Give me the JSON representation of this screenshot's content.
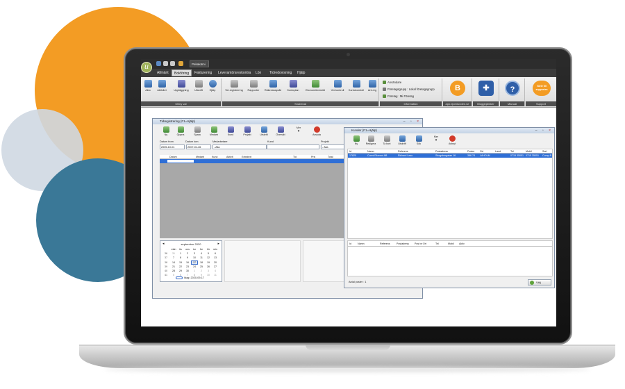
{
  "app": {
    "logo_letter": "u",
    "tab_title": "Pekakämi"
  },
  "menu": [
    "Allmänt",
    "Bokföring",
    "Fakturering",
    "Leverantörsreskontra",
    "Lön",
    "Tidredovisning",
    "Hjälp"
  ],
  "ribbon": {
    "group1_label": "Meny val",
    "group1_buttons": [
      "Akto",
      "Aktivitet",
      "Upplägg­ning",
      "Utskrift",
      "Hjälp"
    ],
    "group2_label": "Snabbval",
    "group2_buttons": [
      "Ver.registrering",
      "Rapporter",
      "Räkenskapsår",
      "Kontoplan",
      "Ekonomiöversikt",
      "Ver.kontroll",
      "Kontokontroll",
      "Ant.reg"
    ],
    "info_label": "Information",
    "info_lines": [
      "Användare",
      "Företagsgrupp : Lokal företagsgrupp",
      "Företag : Mi Företag"
    ],
    "tile_labels": [
      "app.bjornlunden.se",
      "Bloggbjämker",
      "Manual",
      "Support"
    ],
    "support_bubble": "Skriv till supporten"
  },
  "time_window": {
    "title": "Tidregistrering (F1=Hjälp)",
    "toolbar": [
      "Ny",
      "Öppna",
      "Spara",
      "Medarb",
      "Kund",
      "Projekt",
      "Utskrift",
      "Översikt",
      "Mer",
      "Avsluta"
    ],
    "filter_labels": [
      "Datum from",
      "Datum tom",
      "Medarbetare",
      "Kund",
      "Projekt"
    ],
    "filter_values": [
      "2005-10-01",
      "2007-01-26",
      "- Alla",
      "",
      "- Alla"
    ],
    "columns": [
      "Datum",
      "Medarb",
      "Kund",
      "Aktivit",
      "Extratext",
      "Tid",
      "Pris",
      "Total"
    ],
    "calendar": {
      "month": "september 2020",
      "weekdays": [
        "mån",
        "tis",
        "ons",
        "tor",
        "fre",
        "lör",
        "sön"
      ],
      "weeks": [
        {
          "wk": "36",
          "days": [
            "31",
            "1",
            "2",
            "3",
            "4",
            "5",
            "6"
          ]
        },
        {
          "wk": "37",
          "days": [
            "7",
            "8",
            "9",
            "10",
            "11",
            "12",
            "13"
          ]
        },
        {
          "wk": "38",
          "days": [
            "14",
            "15",
            "16",
            "17",
            "18",
            "19",
            "20"
          ]
        },
        {
          "wk": "39",
          "days": [
            "21",
            "22",
            "23",
            "24",
            "25",
            "26",
            "27"
          ]
        },
        {
          "wk": "40",
          "days": [
            "28",
            "29",
            "30",
            "1",
            "2",
            "3",
            "4"
          ]
        },
        {
          "wk": "41",
          "days": [
            "5",
            "6",
            "7",
            "8",
            "9",
            "10",
            "11"
          ]
        }
      ],
      "today_label": "Idag: 2020-09-17"
    }
  },
  "customer_window": {
    "title": "Kunder (F1=Hjälp)",
    "toolbar": [
      "Ny",
      "Redigera",
      "Ta bort",
      "Utskrift",
      "Sök",
      "Mer",
      "Avbryt"
    ],
    "columns": [
      "Id",
      "Namn",
      "Referens",
      "Postadress",
      "Postnr",
      "Ort",
      "Land",
      "Tel",
      "Mobil",
      "Sort"
    ],
    "row": [
      "17820",
      "Conni Ekenrot AB",
      "Richard Leso",
      "Skogsbrogatan 16",
      "386 74",
      "LAHOLM",
      "",
      "0715 35051",
      "0715 35051",
      "Comp.B"
    ],
    "lower_columns": [
      "Id",
      "Namn",
      "Referens",
      "Postadress",
      "Post nr",
      "Ort",
      "Tel",
      "Mobil",
      "Ak­tiv"
    ],
    "status": "Antal poster : 1",
    "ok_label": "Välj"
  },
  "colors": {
    "orange": "#f39c24",
    "light_circle": "#cfd8e2",
    "blue_circle": "#3a7897",
    "selection": "#2f6fd6",
    "tile_orange": "#f39c24",
    "tile_blue": "#2f5fa8"
  }
}
